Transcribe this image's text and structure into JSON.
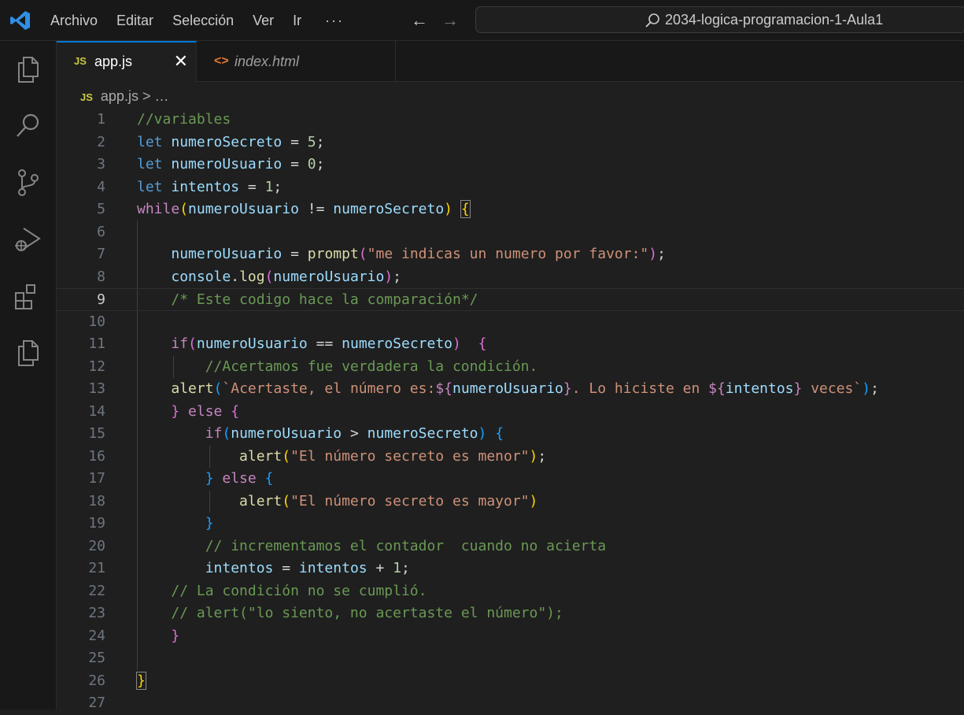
{
  "menu": {
    "items": [
      "Archivo",
      "Editar",
      "Selección",
      "Ver",
      "Ir"
    ],
    "more": "···"
  },
  "nav": {
    "back": "←",
    "forward": "→"
  },
  "search": {
    "text": "2034-logica-programacion-1-Aula1"
  },
  "tabs": [
    {
      "icon": "JS",
      "label": "app.js",
      "close": "✕"
    },
    {
      "icon": "<>",
      "label": "index.html"
    }
  ],
  "breadcrumb": {
    "icon": "JS",
    "file": "app.js",
    "sep": " > …"
  },
  "editor": {
    "current_line": 9,
    "line_numbers": [
      "1",
      "2",
      "3",
      "4",
      "5",
      "6",
      "7",
      "8",
      "9",
      "10",
      "11",
      "12",
      "13",
      "14",
      "15",
      "16",
      "17",
      "18",
      "19",
      "20",
      "21",
      "22",
      "23",
      "24",
      "25",
      "26",
      "27"
    ],
    "lines": [
      [
        [
          "cm",
          "//variables"
        ]
      ],
      [
        [
          "k",
          "let "
        ],
        [
          "v",
          "numeroSecreto"
        ],
        [
          "p",
          " = "
        ],
        [
          "n",
          "5"
        ],
        [
          "p",
          ";"
        ]
      ],
      [
        [
          "k",
          "let "
        ],
        [
          "v",
          "numeroUsuario"
        ],
        [
          "p",
          " = "
        ],
        [
          "n",
          "0"
        ],
        [
          "p",
          ";"
        ]
      ],
      [
        [
          "k",
          "let "
        ],
        [
          "v",
          "intentos"
        ],
        [
          "p",
          " = "
        ],
        [
          "n",
          "1"
        ],
        [
          "p",
          ";"
        ]
      ],
      [
        [
          "c",
          "while"
        ],
        [
          "b1",
          "("
        ],
        [
          "v",
          "numeroUsuario"
        ],
        [
          "p",
          " != "
        ],
        [
          "v",
          "numeroSecreto"
        ],
        [
          "b1",
          ")"
        ],
        [
          "p",
          " "
        ],
        [
          "b1box",
          "{"
        ]
      ],
      [],
      [
        [
          "p",
          "    "
        ],
        [
          "v",
          "numeroUsuario"
        ],
        [
          "p",
          " = "
        ],
        [
          "f",
          "prompt"
        ],
        [
          "b2",
          "("
        ],
        [
          "s",
          "\"me indicas un numero por favor:\""
        ],
        [
          "b2",
          ")"
        ],
        [
          "p",
          ";"
        ]
      ],
      [
        [
          "p",
          "    "
        ],
        [
          "v",
          "console"
        ],
        [
          "p",
          "."
        ],
        [
          "f",
          "log"
        ],
        [
          "b2",
          "("
        ],
        [
          "v",
          "numeroUsuario"
        ],
        [
          "b2",
          ")"
        ],
        [
          "p",
          ";"
        ]
      ],
      [
        [
          "p",
          "    "
        ],
        [
          "cm",
          "/* Este codigo hace la comparación*/"
        ]
      ],
      [],
      [
        [
          "p",
          "    "
        ],
        [
          "c",
          "if"
        ],
        [
          "b2",
          "("
        ],
        [
          "v",
          "numeroUsuario"
        ],
        [
          "p",
          " == "
        ],
        [
          "v",
          "numeroSecreto"
        ],
        [
          "b2",
          ")"
        ],
        [
          "p",
          "  "
        ],
        [
          "b2",
          "{"
        ]
      ],
      [
        [
          "p",
          "        "
        ],
        [
          "cm",
          "//Acertamos fue verdadera la condición."
        ]
      ],
      [
        [
          "p",
          "    "
        ],
        [
          "f",
          "alert"
        ],
        [
          "b3",
          "("
        ],
        [
          "s",
          "`Acertaste, el número es:"
        ],
        [
          "c",
          "${"
        ],
        [
          "v",
          "numeroUsuario"
        ],
        [
          "c",
          "}"
        ],
        [
          "s",
          ". Lo hiciste en "
        ],
        [
          "c",
          "${"
        ],
        [
          "v",
          "intentos"
        ],
        [
          "c",
          "}"
        ],
        [
          "s",
          " veces`"
        ],
        [
          "b3",
          ")"
        ],
        [
          "p",
          ";"
        ]
      ],
      [
        [
          "p",
          "    "
        ],
        [
          "b2",
          "}"
        ],
        [
          "c",
          " else "
        ],
        [
          "b2",
          "{"
        ]
      ],
      [
        [
          "p",
          "        "
        ],
        [
          "c",
          "if"
        ],
        [
          "b3",
          "("
        ],
        [
          "v",
          "numeroUsuario"
        ],
        [
          "p",
          " > "
        ],
        [
          "v",
          "numeroSecreto"
        ],
        [
          "b3",
          ")"
        ],
        [
          "p",
          " "
        ],
        [
          "b3",
          "{"
        ]
      ],
      [
        [
          "p",
          "            "
        ],
        [
          "f",
          "alert"
        ],
        [
          "b1",
          "("
        ],
        [
          "s",
          "\"El número secreto es menor\""
        ],
        [
          "b1",
          ")"
        ],
        [
          "p",
          ";"
        ]
      ],
      [
        [
          "p",
          "        "
        ],
        [
          "b3",
          "}"
        ],
        [
          "c",
          " else "
        ],
        [
          "b3",
          "{"
        ]
      ],
      [
        [
          "p",
          "            "
        ],
        [
          "f",
          "alert"
        ],
        [
          "b1",
          "("
        ],
        [
          "s",
          "\"El número secreto es mayor\""
        ],
        [
          "b1",
          ")"
        ]
      ],
      [
        [
          "p",
          "        "
        ],
        [
          "b3",
          "}"
        ]
      ],
      [
        [
          "p",
          "        "
        ],
        [
          "cm",
          "// incrementamos el contador  cuando no acierta"
        ]
      ],
      [
        [
          "p",
          "        "
        ],
        [
          "v",
          "intentos"
        ],
        [
          "p",
          " = "
        ],
        [
          "v",
          "intentos"
        ],
        [
          "p",
          " + "
        ],
        [
          "n",
          "1"
        ],
        [
          "p",
          ";"
        ]
      ],
      [
        [
          "p",
          "    "
        ],
        [
          "cm",
          "// La condición no se cumplió."
        ]
      ],
      [
        [
          "p",
          "    "
        ],
        [
          "cm",
          "// alert(\"lo siento, no acertaste el número\");"
        ]
      ],
      [
        [
          "p",
          "    "
        ],
        [
          "b2",
          "}"
        ]
      ],
      [],
      [
        [
          "b1box",
          "}"
        ]
      ],
      []
    ]
  }
}
